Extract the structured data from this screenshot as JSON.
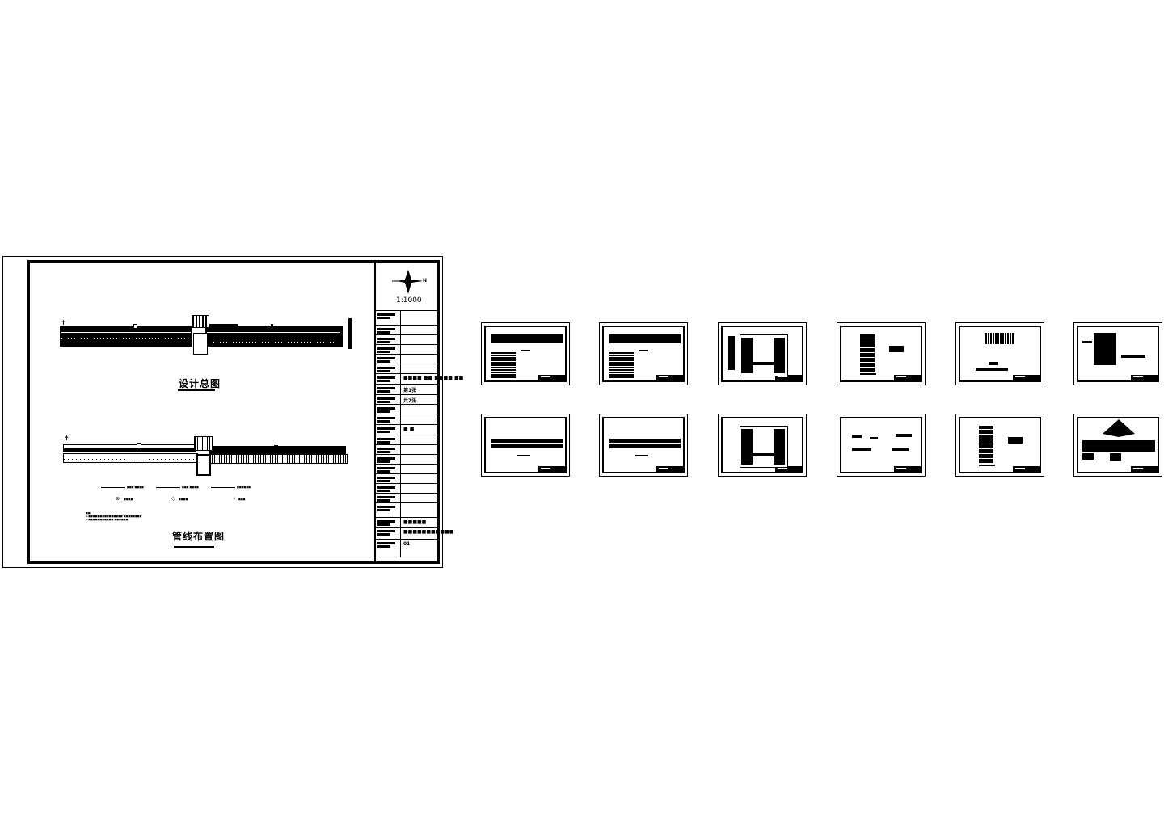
{
  "main_sheet": {
    "plan_title": "设计总图",
    "pipeline_title": "管线布置图",
    "north_label": "N",
    "scale": "1:1000",
    "title_block": {
      "rows": [
        {
          "value": ""
        },
        {
          "value": ""
        },
        {
          "value": ""
        },
        {
          "value": ""
        },
        {
          "value": ""
        },
        {
          "value": ""
        },
        {
          "value": "■■■■ ■■ ■■■■ ■■"
        },
        {
          "value": "第1张"
        },
        {
          "value": "共7张"
        },
        {
          "value": ""
        },
        {
          "value": ""
        },
        {
          "value": "■ ■"
        },
        {
          "value": ""
        },
        {
          "value": ""
        },
        {
          "value": ""
        },
        {
          "value": ""
        },
        {
          "value": ""
        },
        {
          "value": ""
        },
        {
          "value": ""
        },
        {
          "value": ""
        },
        {
          "value": "■■■■■"
        },
        {
          "value": "■■■■■■■■■■■"
        },
        {
          "value": "01"
        }
      ]
    },
    "legend": {
      "lines": [
        "■■■ ■■■■",
        "■■■ ■■■■",
        "■■■■■■"
      ],
      "symbols": [
        "■■■■",
        "■■■■",
        "■■■"
      ],
      "notes_heading": "■■",
      "notes": [
        "1.■■■■■■■■■■■■■■■ ■■■■■■■■",
        "2.■■■■■■■■■■■ ■■■■■■"
      ]
    }
  },
  "thumbnails": [
    {
      "kind": "plan-with-table"
    },
    {
      "kind": "plan-with-table"
    },
    {
      "kind": "square-plan"
    },
    {
      "kind": "section-detail"
    },
    {
      "kind": "paving-detail"
    },
    {
      "kind": "block-detail"
    },
    {
      "kind": "road-plan"
    },
    {
      "kind": "road-plan"
    },
    {
      "kind": "square-plan"
    },
    {
      "kind": "text-notes"
    },
    {
      "kind": "section-detail"
    },
    {
      "kind": "elevation"
    }
  ]
}
